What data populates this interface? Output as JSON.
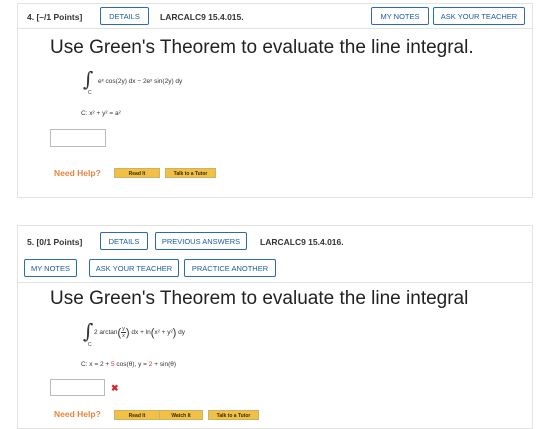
{
  "q4": {
    "number": "4.",
    "points": "[–/1 Points]",
    "details_label": "DETAILS",
    "code": "LARCALC9 15.4.015.",
    "my_notes_label": "MY NOTES",
    "ask_teacher_label": "ASK YOUR TEACHER",
    "prompt": "Use Green's Theorem to evaluate the line integral.",
    "integral_sub": "C",
    "integrand": "eˣ cos(2y) dx − 2eˣ sin(2y) dy",
    "curve": "C: x² + y² = a²",
    "answer_value": "",
    "need_help": "Need Help?",
    "read_it": "Read It",
    "talk_tutor": "Talk to a Tutor"
  },
  "q5": {
    "number": "5.",
    "points": "[0/1 Points]",
    "details_label": "DETAILS",
    "previous_answers_label": "PREVIOUS ANSWERS",
    "code": "LARCALC9 15.4.016.",
    "my_notes_label": "MY NOTES",
    "ask_teacher_label": "ASK YOUR TEACHER",
    "practice_label": "PRACTICE ANOTHER",
    "prompt": "Use Green's Theorem to evaluate the line integral",
    "integral_sub": "C",
    "integrand_a": "2 arctan",
    "frac_num": "y",
    "frac_den": "x",
    "integrand_b": "dx + ln",
    "integrand_c": "x² + y²",
    "integrand_d": "dy",
    "curve_a": "C: x = 2 + ",
    "curve_red1": "5",
    "curve_b": " cos(θ),  y = ",
    "curve_red2": "2",
    "curve_c": " + sin(θ)",
    "answer_value": "",
    "wrong_mark": "✖",
    "need_help": "Need Help?",
    "read_it": "Read It",
    "watch_it": "Watch It",
    "talk_tutor": "Talk to a Tutor"
  }
}
